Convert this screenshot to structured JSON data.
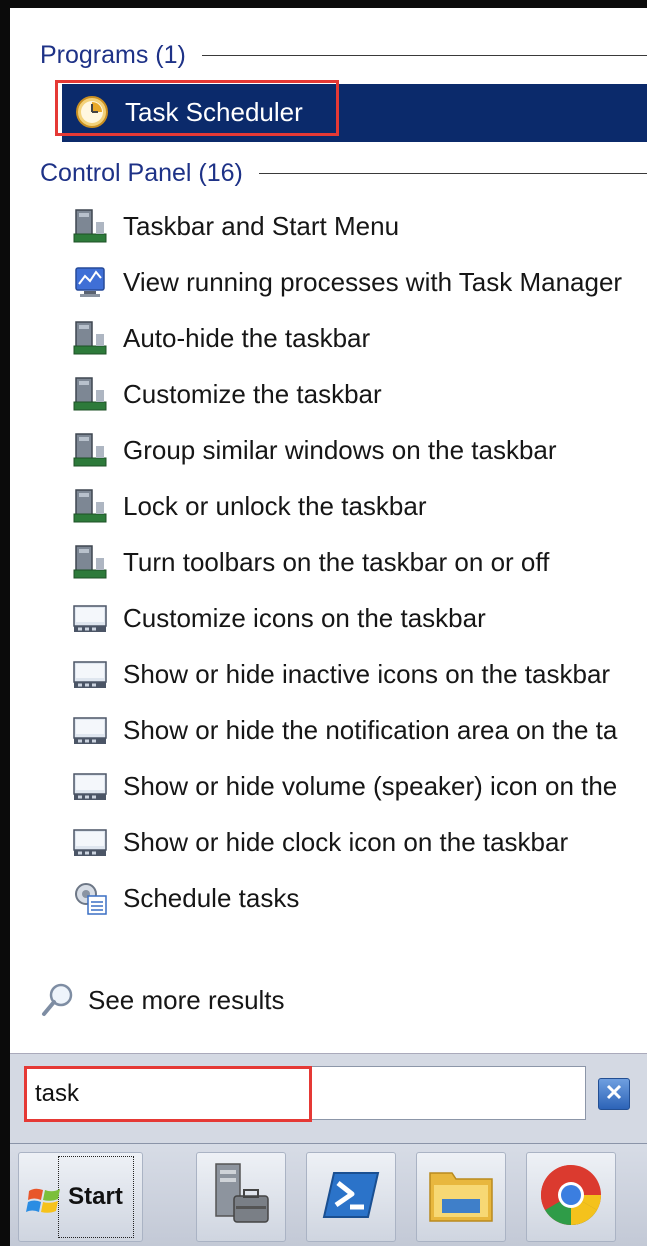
{
  "start_menu": {
    "programs_header": "Programs (1)",
    "programs": [
      {
        "label": "Task Scheduler",
        "icon": "task-scheduler-clock-icon",
        "selected": true
      }
    ],
    "control_panel_header": "Control Panel (16)",
    "control_panel_items": [
      {
        "label": "Taskbar and Start Menu",
        "icon": "taskbar-settings-icon"
      },
      {
        "label": "View running processes with Task Manager",
        "icon": "task-manager-icon"
      },
      {
        "label": "Auto-hide the taskbar",
        "icon": "taskbar-settings-icon"
      },
      {
        "label": "Customize the taskbar",
        "icon": "taskbar-settings-icon"
      },
      {
        "label": "Group similar windows on the taskbar",
        "icon": "taskbar-settings-icon"
      },
      {
        "label": "Lock or unlock the taskbar",
        "icon": "taskbar-settings-icon"
      },
      {
        "label": "Turn toolbars on the taskbar on or off",
        "icon": "taskbar-settings-icon"
      },
      {
        "label": "Customize icons on the taskbar",
        "icon": "notification-area-icon"
      },
      {
        "label": "Show or hide inactive icons on the taskbar",
        "icon": "notification-area-icon"
      },
      {
        "label": "Show or hide the notification area on the ta",
        "icon": "notification-area-icon"
      },
      {
        "label": "Show or hide volume (speaker) icon on the",
        "icon": "notification-area-icon"
      },
      {
        "label": "Show or hide clock icon on the taskbar",
        "icon": "notification-area-icon"
      },
      {
        "label": "Schedule tasks",
        "icon": "schedule-tasks-icon"
      }
    ],
    "see_more": "See more results",
    "search": {
      "value": "task",
      "placeholder": ""
    }
  },
  "taskbar": {
    "start_label": "Start",
    "pinned": [
      "server-manager-icon",
      "powershell-icon",
      "file-explorer-icon",
      "chrome-icon"
    ]
  },
  "colors": {
    "selection": "#0b2a6b",
    "highlight_box": "#e53935",
    "header_text": "#1e3287"
  }
}
